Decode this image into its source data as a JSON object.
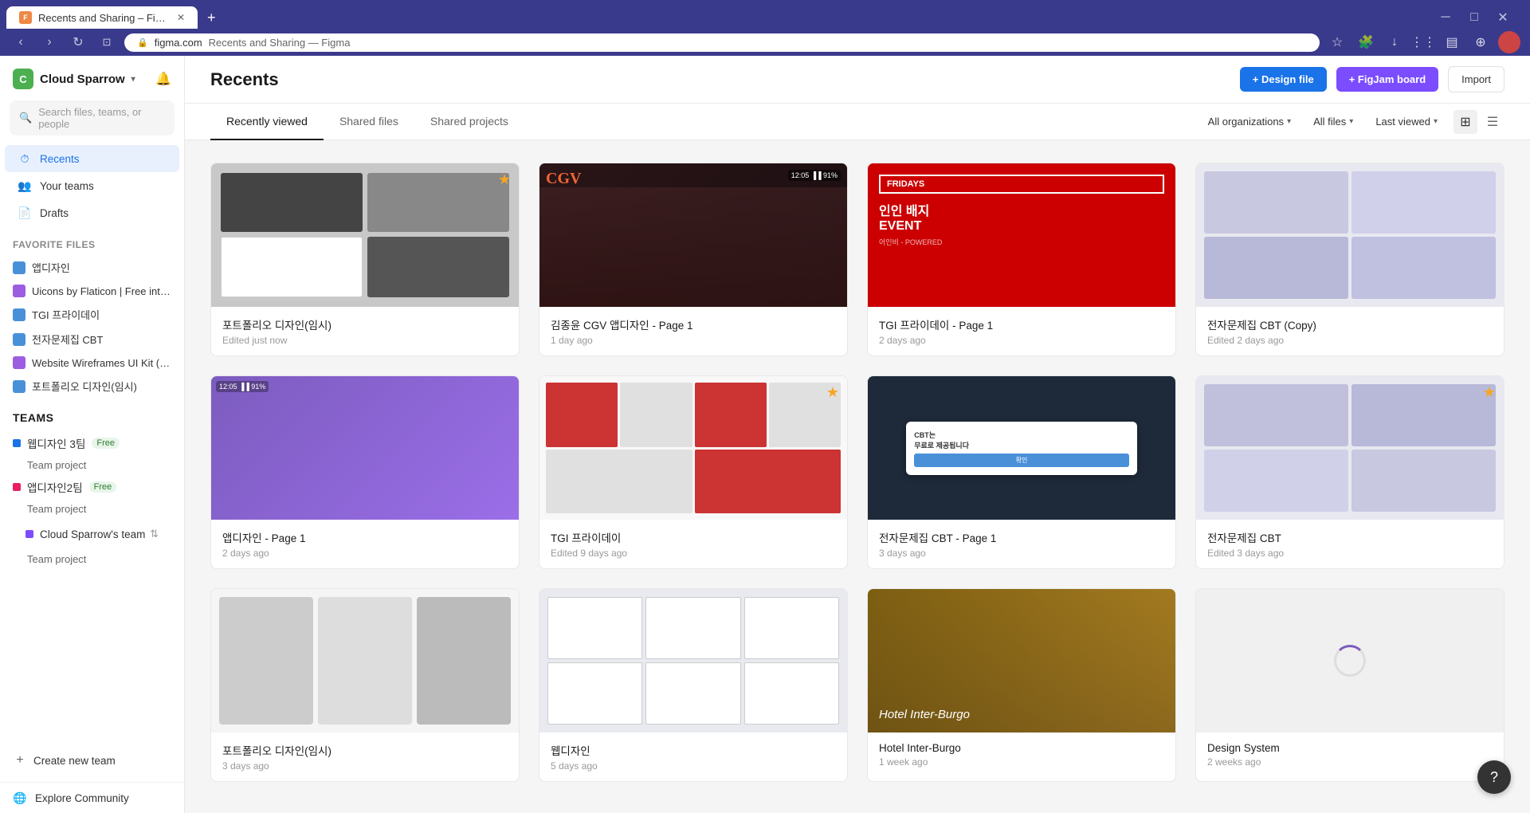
{
  "browser": {
    "url_domain": "figma.com",
    "url_path": "Recents and Sharing — Figma",
    "tab_label": "Recents and Sharing – Figm...",
    "favicon_color": "#e94"
  },
  "sidebar": {
    "org_name": "Cloud Sparrow",
    "org_initial": "C",
    "search_placeholder": "Search files, teams, or people",
    "nav": {
      "recents_label": "Recents",
      "your_teams_label": "Your teams",
      "drafts_label": "Drafts"
    },
    "favorite_files_section": "Favorite files",
    "favorite_files": [
      {
        "label": "앱디자인",
        "color": "#4a90d9"
      },
      {
        "label": "Uicons by Flaticon | Free interface ic...",
        "color": "#9c5de0"
      },
      {
        "label": "TGI 프라이데이",
        "color": "#4a90d9"
      },
      {
        "label": "전자문제집 CBT",
        "color": "#4a90d9"
      },
      {
        "label": "Website Wireframes UI Kit (Communi...",
        "color": "#9c5de0"
      },
      {
        "label": "포트폴리오 디자인(임시)",
        "color": "#4a90d9"
      }
    ],
    "teams_header": "Teams",
    "teams": [
      {
        "name": "웹디자인 3팀",
        "color": "#1a73e8",
        "badge": "Free",
        "subitem": "Team project"
      },
      {
        "name": "앱디자인2팀",
        "color": "#e91e63",
        "badge": "Free",
        "subitem": "Team project"
      },
      {
        "name": "Cloud Sparrow's team",
        "color": "#7c4dff",
        "badge": null,
        "subitem": "Team project"
      }
    ],
    "create_team_label": "Create new team",
    "explore_label": "Explore Community"
  },
  "main": {
    "page_title": "Recents",
    "actions": {
      "design_file": "+ Design file",
      "figjam_board": "+ FigJam board",
      "import": "Import"
    },
    "tabs": [
      {
        "label": "Recently viewed",
        "active": true
      },
      {
        "label": "Shared files",
        "active": false
      },
      {
        "label": "Shared projects",
        "active": false
      }
    ],
    "filters": {
      "all_organizations": "All organizations",
      "all_files": "All files",
      "last_viewed": "Last viewed"
    },
    "files": [
      {
        "name": "포트폴리오 디자인(임시)",
        "meta": "Edited just now",
        "thumb_type": "portfolio",
        "starred": true
      },
      {
        "name": "김종윤 CGV 앱디자인 - Page 1",
        "meta": "1 day ago",
        "thumb_type": "cgv",
        "starred": false
      },
      {
        "name": "TGI 프라이데이 - Page 1",
        "meta": "2 days ago",
        "thumb_type": "tgi_red",
        "starred": false
      },
      {
        "name": "전자문제집 CBT (Copy)",
        "meta": "Edited 2 days ago",
        "thumb_type": "cbt_copy",
        "starred": false
      },
      {
        "name": "앱디자인 - Page 1",
        "meta": "2 days ago",
        "thumb_type": "app_purple",
        "starred": false
      },
      {
        "name": "TGI 프라이데이",
        "meta": "Edited 9 days ago",
        "thumb_type": "tgi_file",
        "starred": true
      },
      {
        "name": "전자문제집 CBT - Page 1",
        "meta": "3 days ago",
        "thumb_type": "cbt_dark",
        "starred": false
      },
      {
        "name": "전자문제집 CBT",
        "meta": "Edited 3 days ago",
        "thumb_type": "cbt_main",
        "starred": true
      },
      {
        "name": "포트폴리오 디자인(임시)",
        "meta": "3 days ago",
        "thumb_type": "portfolio2",
        "starred": false
      },
      {
        "name": "웹디자인",
        "meta": "5 days ago",
        "thumb_type": "wireframe2",
        "starred": false
      },
      {
        "name": "Hotel Inter-Burgo",
        "meta": "1 week ago",
        "thumb_type": "hotel",
        "starred": false
      },
      {
        "name": "Design System",
        "meta": "2 weeks ago",
        "thumb_type": "loading",
        "starred": false
      }
    ]
  }
}
